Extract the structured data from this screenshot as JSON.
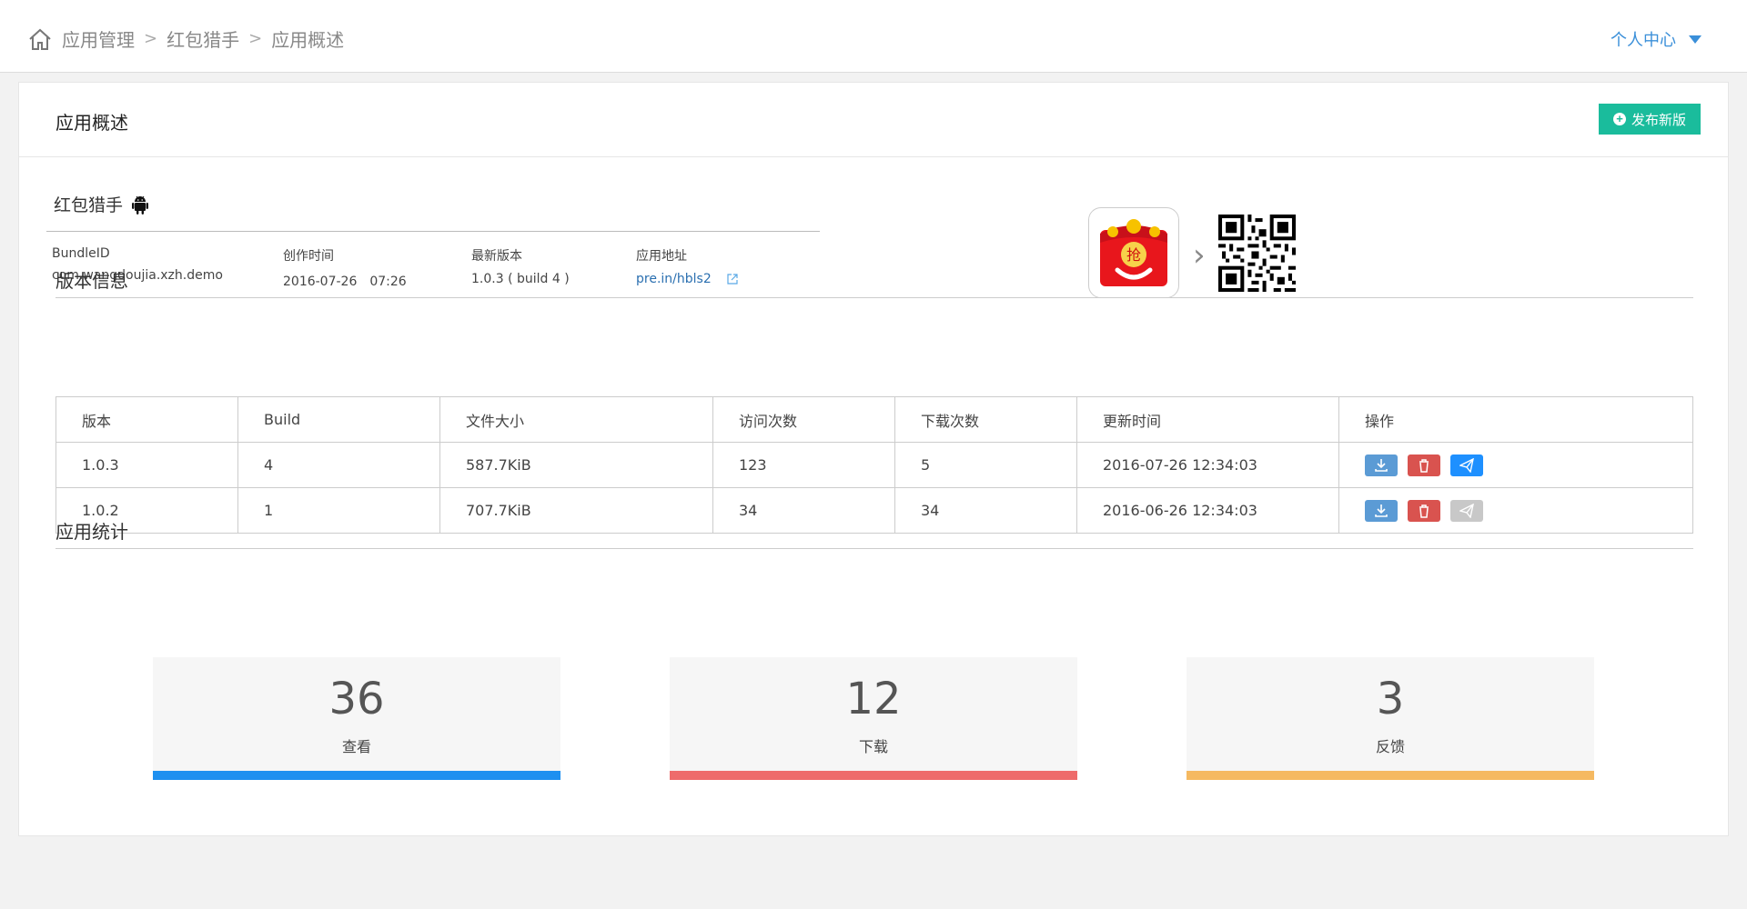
{
  "breadcrumb": [
    "应用管理",
    "红包猎手",
    "应用概述"
  ],
  "user_menu": "个人中心",
  "page_title": "应用概述",
  "publish_button": "发布新版",
  "app": {
    "name": "红包猎手",
    "platform_icon": "android-icon",
    "bundle_label": "BundleID",
    "bundle_value": "com.wangdoujia.xzh.demo",
    "created_label": "创作时间",
    "created_value": "2016-07-26　07:26",
    "latest_label": "最新版本",
    "latest_value": "1.0.3 ( build 4 )",
    "url_label": "应用地址",
    "url_value": "pre.in/hbls2",
    "icon_char": "抢"
  },
  "version_section_title": "版本信息",
  "table": {
    "headers": [
      "版本",
      "Build",
      "文件大小",
      "访问次数",
      "下载次数",
      "更新时间",
      "操作"
    ],
    "rows": [
      [
        "1.0.3",
        "4",
        "587.7KiB",
        "123",
        "5",
        "2016-07-26 12:34:03"
      ],
      [
        "1.0.2",
        "1",
        "707.7KiB",
        "34",
        "34",
        "2016-06-26 12:34:03"
      ]
    ]
  },
  "stats_section_title": "应用统计",
  "stats": [
    {
      "value": "36",
      "label": "查看",
      "color": "#1e90f0"
    },
    {
      "value": "12",
      "label": "下载",
      "color": "#ee6b6b"
    },
    {
      "value": "3",
      "label": "反馈",
      "color": "#f5b961"
    }
  ]
}
